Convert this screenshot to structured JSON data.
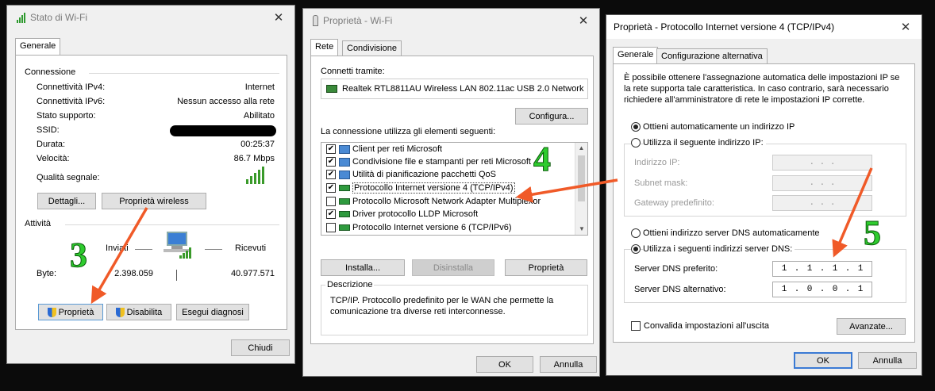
{
  "colors": {
    "arrow": "#f05a28",
    "annotation": "#2ecc2e",
    "signal": "#3a9a2a"
  },
  "wifi_status": {
    "title": "Stato di Wi-Fi",
    "tab": "Generale",
    "connection_section": "Connessione",
    "rows": [
      {
        "label": "Connettività IPv4:",
        "value": "Internet"
      },
      {
        "label": "Connettività IPv6:",
        "value": "Nessun accesso alla rete"
      },
      {
        "label": "Stato supporto:",
        "value": "Abilitato"
      },
      {
        "label": "SSID:",
        "value": ""
      },
      {
        "label": "Durata:",
        "value": "00:25:37"
      },
      {
        "label": "Velocità:",
        "value": "86.7 Mbps"
      }
    ],
    "signal_label": "Qualità segnale:",
    "details_button": "Dettagli...",
    "wireless_props_button": "Proprietà wireless",
    "activity_section": "Attività",
    "sent_label": "Inviati",
    "received_label": "Ricevuti",
    "bytes_label": "Byte:",
    "bytes_sent": "2.398.059",
    "bytes_received": "40.977.571",
    "properties_button": "Proprietà",
    "disable_button": "Disabilita",
    "diagnose_button": "Esegui diagnosi",
    "close_button": "Chiudi"
  },
  "wifi_props": {
    "title": "Proprietà - Wi-Fi",
    "tabs": [
      "Rete",
      "Condivisione"
    ],
    "connect_using_label": "Connetti tramite:",
    "adapter": "Realtek RTL8811AU Wireless LAN 802.11ac USB 2.0 Network",
    "configure_button": "Configura...",
    "items_label": "La connessione utilizza gli elementi seguenti:",
    "items": [
      {
        "label": "Client per reti Microsoft",
        "checked": true,
        "icon": "network-client-icon"
      },
      {
        "label": "Condivisione file e stampanti per reti Microsoft",
        "checked": true,
        "icon": "network-client-icon"
      },
      {
        "label": "Utilità di pianificazione pacchetti QoS",
        "checked": true,
        "icon": "network-client-icon"
      },
      {
        "label": "Protocollo Internet versione 4 (TCP/IPv4)",
        "checked": true,
        "icon": "protocol-icon"
      },
      {
        "label": "Protocollo Microsoft Network Adapter Multiplexor",
        "checked": false,
        "icon": "protocol-icon"
      },
      {
        "label": "Driver protocollo LLDP Microsoft",
        "checked": true,
        "icon": "protocol-icon"
      },
      {
        "label": "Protocollo Internet versione 6 (TCP/IPv6)",
        "checked": false,
        "icon": "protocol-icon"
      }
    ],
    "install_button": "Installa...",
    "uninstall_button": "Disinstalla",
    "properties_button": "Proprietà",
    "description_title": "Descrizione",
    "description_text": "TCP/IP. Protocollo predefinito per le WAN che permette la comunicazione tra diverse reti interconnesse.",
    "ok_button": "OK",
    "cancel_button": "Annulla"
  },
  "ipv4_props": {
    "title": "Proprietà - Protocollo Internet versione 4 (TCP/IPv4)",
    "tabs": [
      "Generale",
      "Configurazione alternativa"
    ],
    "intro": "È possibile ottenere l'assegnazione automatica delle impostazioni IP se la rete supporta tale caratteristica. In caso contrario, sarà necessario richiedere all'amministratore di rete le impostazioni IP corrette.",
    "auto_ip": "Ottieni automaticamente un indirizzo IP",
    "manual_ip": "Utilizza il seguente indirizzo IP:",
    "ip_address_label": "Indirizzo IP:",
    "subnet_label": "Subnet mask:",
    "gateway_label": "Gateway predefinito:",
    "empty_ip": ". . .",
    "auto_dns": "Ottieni indirizzo server DNS automaticamente",
    "manual_dns": "Utilizza i seguenti indirizzi server DNS:",
    "preferred_dns_label": "Server DNS preferito:",
    "alternate_dns_label": "Server DNS alternativo:",
    "preferred_dns": [
      "1",
      "1",
      "1",
      "1"
    ],
    "alternate_dns": [
      "1",
      "0",
      "0",
      "1"
    ],
    "validate_label": "Convalida impostazioni all'uscita",
    "advanced_button": "Avanzate...",
    "ok_button": "OK",
    "cancel_button": "Annulla"
  },
  "annotations": {
    "step3": "3",
    "step4": "4",
    "step5": "5"
  }
}
